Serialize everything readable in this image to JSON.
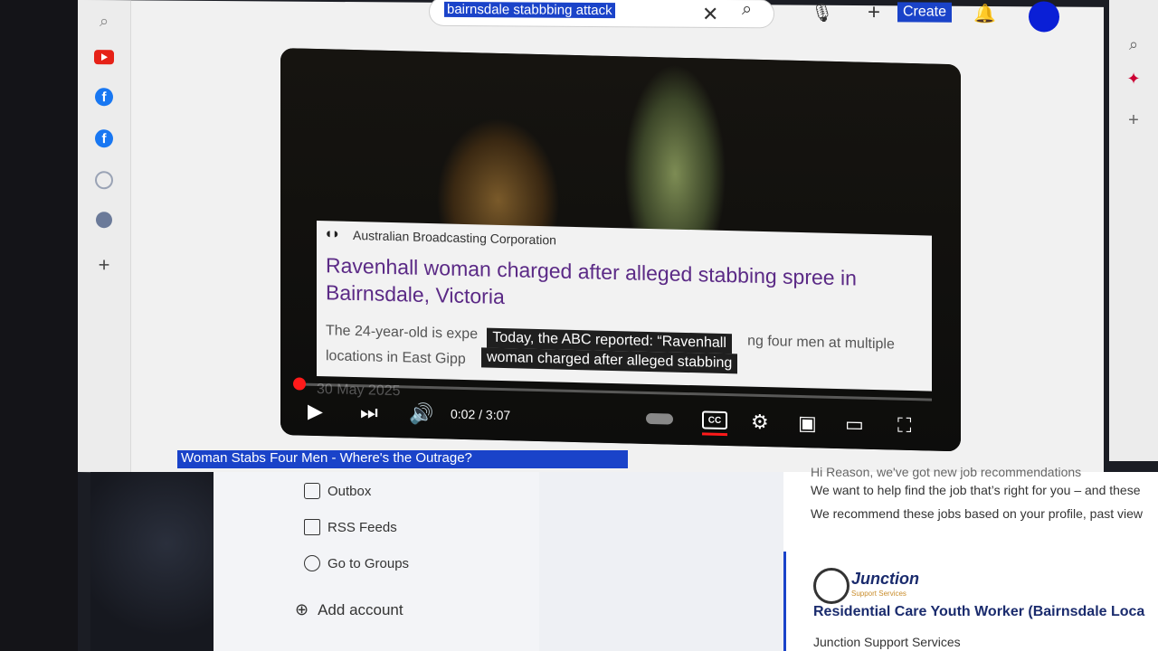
{
  "browser": {
    "search_query": "bairnsdale stabbbing attack",
    "create_label": "Create"
  },
  "video": {
    "publisher": "Australian Broadcasting Corporation",
    "headline": "Ravenhall woman charged after alleged stabbing spree in Bairnsdale, Victoria",
    "snippet_part1": "The 24-year-old is expe",
    "snippet_part2": "ng four men at multiple",
    "snippet_line2": "locations in East Gipp",
    "date": "30 May 2025",
    "caption_line1": "Today, the ABC reported: “Ravenhall",
    "caption_line2": "woman charged after alleged stabbing",
    "time": "0:02 / 3:07",
    "cc_label": "CC",
    "progress_fraction": 0.01
  },
  "next_video_title": "Woman Stabs Four Men - Where's the Outrage?",
  "mail": {
    "items": [
      "Outbox",
      "RSS Feeds",
      "Go to Groups"
    ],
    "add_account": "Add account"
  },
  "jobs": {
    "line0": "Hi Reason, we've got new job recommendations",
    "line1": "We want to help find the job that’s right for you – and these",
    "line2": "We recommend these jobs based on your profile, past view",
    "employer_logo_text": "Junction",
    "employer_logo_sub": "Support Services",
    "job_title": "Residential Care Youth Worker (Bairnsdale Loca",
    "company": "Junction Support Services"
  }
}
